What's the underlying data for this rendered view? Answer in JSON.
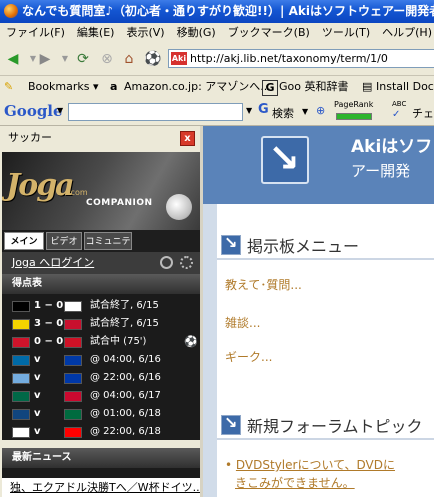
{
  "window": {
    "title": "なんでも質問室♪（初心者・通りすがり歓迎!!）| Akiはソフトウェアー開発者"
  },
  "menu": [
    "ファイル(F)",
    "編集(E)",
    "表示(V)",
    "移動(G)",
    "ブックマーク(B)",
    "ツール(T)",
    "ヘルプ(H)"
  ],
  "nav": {
    "url": "http://akj.lib.net/taxonomy/term/1/0",
    "favicon_text": "Aki"
  },
  "bookmarks": {
    "items": [
      "Bookmarks ▾",
      "Amazon.co.jp: アマゾンへ...",
      "Goo 英和辞書",
      "Install Doc"
    ]
  },
  "google_toolbar": {
    "logo": "Google",
    "search_label": "検索",
    "pagerank": "PageRank",
    "abc": "ABC",
    "check": "チェ"
  },
  "sidebar": {
    "title": "サッカー",
    "close": "x",
    "banner_logo": "Joga",
    "banner_com": ".com",
    "banner_companion": "COMPANION",
    "tabs": [
      "メイン",
      "ビデオ",
      "コミュニティ"
    ],
    "login_link": "Joga へログイン",
    "scores_title": "得点表",
    "news_title": "最新ニュース",
    "news_item": "独、エクアドル決勝Tへ／W杯ドイツ...",
    "matches": [
      {
        "score": "1 − 0",
        "status": "試合終了, 6/15",
        "flags": [
          "#000000",
          "#ffffff"
        ]
      },
      {
        "score": "3 − 0",
        "status": "試合終了, 6/15",
        "flags": [
          "#f4d400",
          "#c8102e"
        ]
      },
      {
        "score": "0 − 0",
        "status": "試合中 (75')",
        "flags": [
          "#cf142b",
          "#ce1126"
        ]
      },
      {
        "score": "v",
        "status": "@ 04:00, 6/16",
        "flags": [
          "#006aa7",
          "#0039a6"
        ]
      },
      {
        "score": "v",
        "status": "@ 22:00, 6/16",
        "flags": [
          "#74acdf",
          "#0038a8"
        ]
      },
      {
        "score": "v",
        "status": "@ 04:00, 6/17",
        "flags": [
          "#006847",
          "#cc092f"
        ]
      },
      {
        "score": "v",
        "status": "@ 01:00, 6/18",
        "flags": [
          "#11457e",
          "#006b3f"
        ]
      },
      {
        "score": "v",
        "status": "@ 22:00, 6/18",
        "flags": [
          "#ffffff",
          "#ff0000"
        ]
      }
    ]
  },
  "main": {
    "site_name_1": "Akiはソフ",
    "site_name_2": "アー開発",
    "forum_menu_title": "掲示板メニュー",
    "forum_links": [
      "教えて･質問...",
      "雑談...",
      "ギーク..."
    ],
    "new_topic_title": "新規フォーラムトピック",
    "topic_line1": "DVDStylerについて、DVDに",
    "topic_line2": "きこみができません。"
  }
}
